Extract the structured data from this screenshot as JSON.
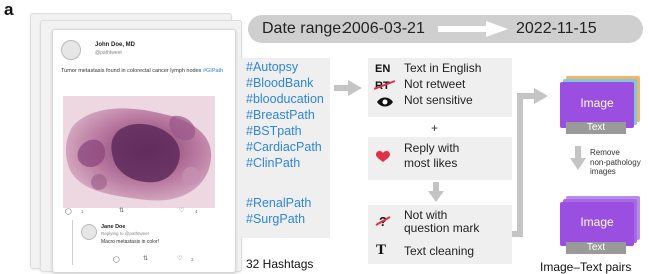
{
  "panel_label": "a",
  "date_range": {
    "label": "Date range:",
    "start": "2006-03-21",
    "end": "2022-11-15"
  },
  "tweet": {
    "author_name": "John Doe, MD",
    "author_handle": "@pathtweet",
    "text": "Tumor metastasis found in colorectal cancer lymph nodes ",
    "hashtag": "#GIPath",
    "reply_count": "1",
    "like_count": "4"
  },
  "reply": {
    "author_name": "Jane Doe",
    "replying_to": "Replying to @pathtweet",
    "text": "Macro metastasis in color!",
    "like_count": "3"
  },
  "hashtags": {
    "items": [
      "#Autopsy",
      "#BloodBank",
      "#blooducation",
      "#BreastPath",
      "#BSTpath",
      "#CardiacPath",
      "#ClinPath"
    ],
    "tail_items": [
      "#RenalPath",
      "#SurgPath"
    ],
    "count_label": "32 Hashtags"
  },
  "filters": {
    "box1": [
      {
        "icon": "EN",
        "label": "Text in English"
      },
      {
        "icon": "RT",
        "label": "Not retweet"
      },
      {
        "icon": "eye-icon",
        "label": "Not sensitive"
      }
    ],
    "plus": "+",
    "box2": {
      "icon": "heart-icon",
      "label_line1": "Reply with",
      "label_line2": "most likes"
    },
    "box3": [
      {
        "icon": "crossed-question-icon",
        "label_line1": "Not with",
        "label_line2": "question mark"
      },
      {
        "icon": "T",
        "label": "Text cleaning"
      }
    ]
  },
  "pairs": {
    "image_label": "Image",
    "text_label": "Text",
    "remove_line1": "Remove",
    "remove_line2": "non-pathology",
    "remove_line3": "images",
    "caption": "Image–Text pairs"
  },
  "colors": {
    "hashtag_blue": "#2e86d6",
    "image_purple": "#9b4fe0",
    "heart_red": "#e0304a",
    "panel_gray": "#efefef"
  }
}
